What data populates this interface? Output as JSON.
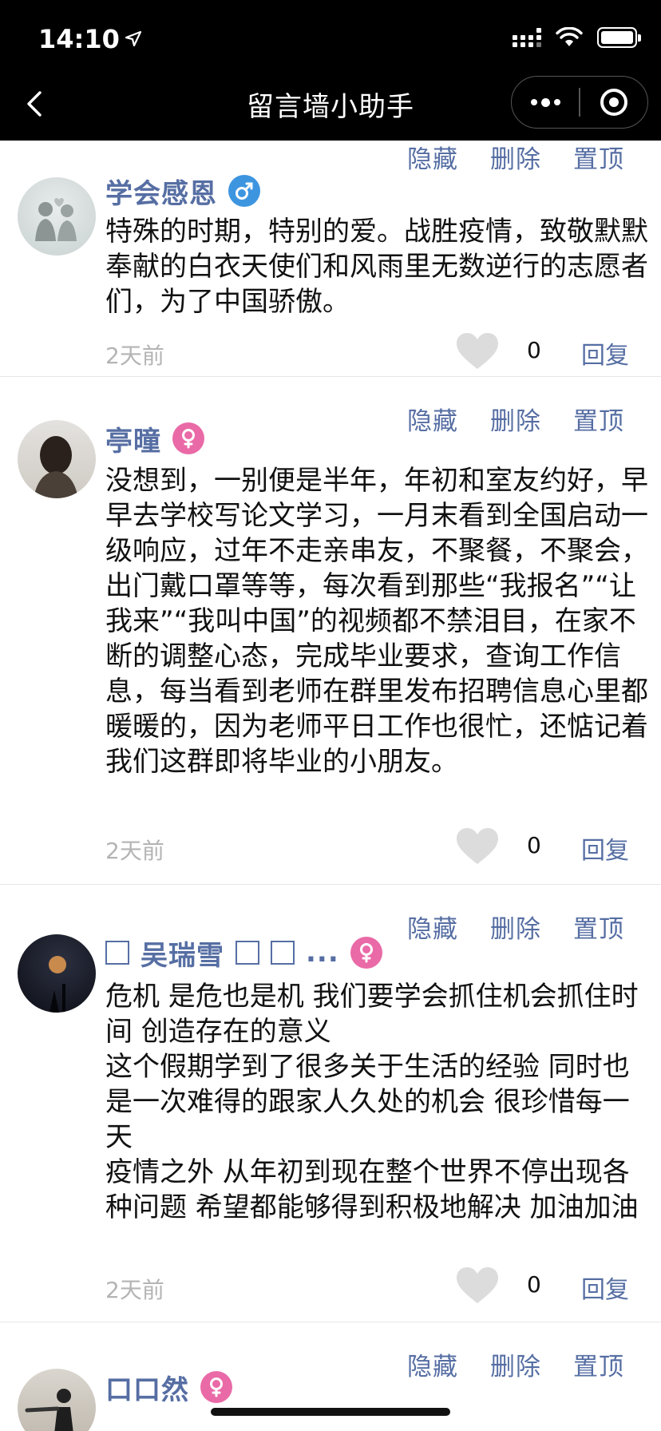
{
  "status_bar": {
    "time": "14:10"
  },
  "nav": {
    "title": "留言墙小助手"
  },
  "actions": {
    "hide": "隐藏",
    "delete": "删除",
    "pin": "置顶"
  },
  "reply_label": "回复",
  "posts": [
    {
      "name": "学会感恩",
      "gender": "male",
      "content": "特殊的时期，特别的爱。战胜疫情，致敬默默奉献的白衣天使们和风雨里无数逆行的志愿者们，为了中国骄傲。",
      "time": "2天前",
      "likes": "0"
    },
    {
      "name": "亭曈",
      "gender": "female",
      "content": "没想到，一别便是半年，年初和室友约好，早早去学校写论文学习，一月末看到全国启动一级响应，过年不走亲串友，不聚餐，不聚会，出门戴口罩等等，每次看到那些“我报名”“让我来”“我叫中国”的视频都不禁泪目，在家不断的调整心态，完成毕业要求，查询工作信息，每当看到老师在群里发布招聘信息心里都暖暖的，因为老师平日工作也很忙，还惦记着我们这群即将毕业的小朋友。",
      "time": "2天前",
      "likes": "0"
    },
    {
      "name": "吴瑞雪",
      "name_ellipsis": "...",
      "gender": "female",
      "content": "危机 是危也是机 我们要学会抓住机会抓住时间 创造存在的意义\n这个假期学到了很多关于生活的经验 同时也是一次难得的跟家人久处的机会 很珍惜每一天\n疫情之外 从年初到现在整个世界不停出现各种问题 希望都能够得到积极地解决 加油加油",
      "time": "2天前",
      "likes": "0"
    },
    {
      "name": "口口然",
      "gender": "female"
    }
  ]
}
